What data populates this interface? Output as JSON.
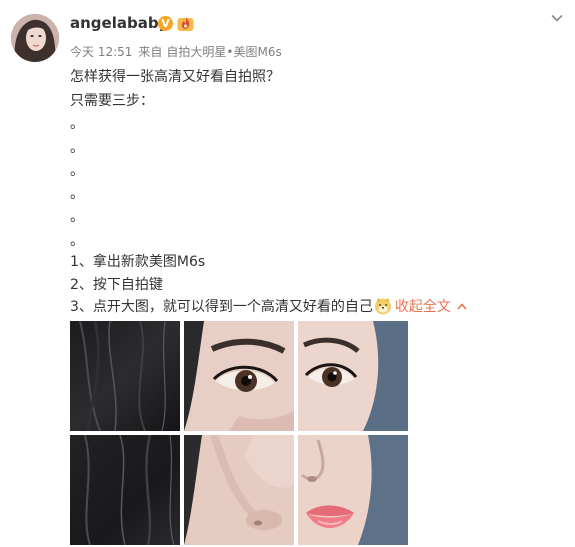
{
  "post": {
    "username": "angelababy",
    "verified_badge": "V",
    "meta": {
      "time": "今天 12:51",
      "source_prefix": "来自",
      "source": "自拍大明星•美图M6s"
    },
    "lines": [
      "怎样获得一张高清又好看自拍照？",
      "只需要三步：",
      "。",
      "。",
      "。",
      "。",
      "。",
      "。",
      "1、拿出新款美图M6s",
      "2、按下自拍键"
    ],
    "last_line": "3、点开大图，就可以得到一个高清又好看的自己",
    "collapse_label": "收起全文",
    "collapse_arrow": "^"
  },
  "icons": {
    "avatar": "avatar-photo",
    "verified": "verified-v-icon",
    "flame": "flame-badge-icon",
    "options": "chevron-down-icon",
    "emoji": "doge-emoji-icon",
    "collapse": "chevron-up-icon"
  },
  "colors": {
    "text": "#333333",
    "meta": "#808080",
    "link": "#eb7350",
    "verified": "#f5a623"
  },
  "images": [
    "hair-photo-1",
    "eye-photo-left",
    "eye-photo-right",
    "hair-photo-2",
    "nose-photo",
    "lips-photo"
  ]
}
